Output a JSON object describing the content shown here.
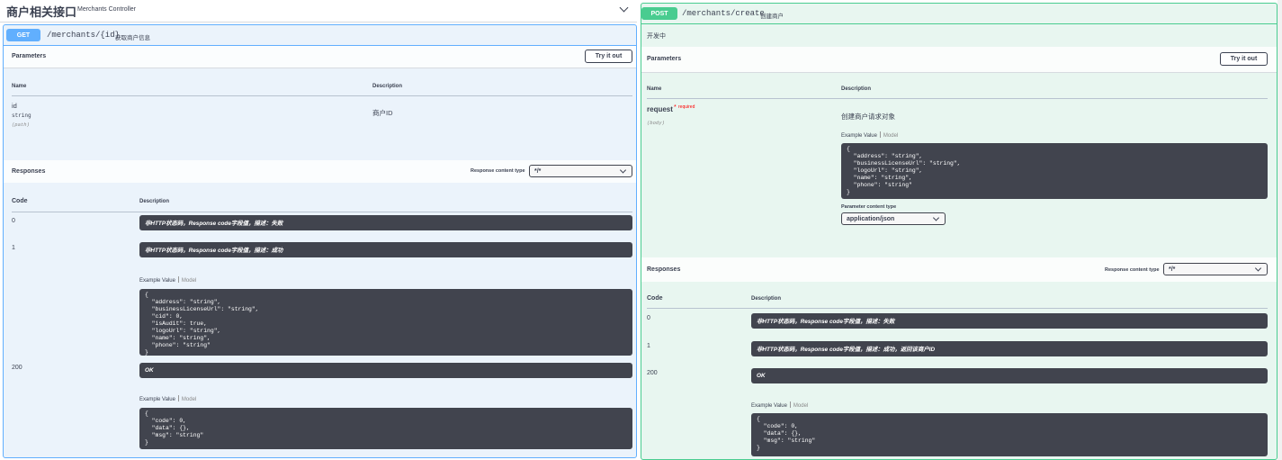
{
  "left": {
    "section_title": "商户相关接口",
    "section_subtitle": "Merchants Controller",
    "op": {
      "method": "GET",
      "path": "/merchants/{id}",
      "summary": "获取商户信息",
      "parameters_title": "Parameters",
      "try_label": "Try it out",
      "col_name": "Name",
      "col_description": "Description",
      "param": {
        "name": "id",
        "type": "string",
        "in": "(path)",
        "description": "商户ID"
      },
      "responses_title": "Responses",
      "content_type_label": "Response content type",
      "content_type_value": "*/*",
      "code_header": "Code",
      "desc_header": "Description",
      "responses": [
        {
          "code": "0",
          "desc": "非HTTP状态码，Response code字段值，描述：失败"
        },
        {
          "code": "1",
          "desc": "非HTTP状态码，Response code字段值，描述：成功"
        },
        {
          "code": "200",
          "desc": "OK"
        }
      ],
      "example_value": "Example Value",
      "model": "Model",
      "example1": "{\n  \"address\": \"string\",\n  \"businessLicenseUrl\": \"string\",\n  \"cid\": 0,\n  \"isAudit\": true,\n  \"logoUrl\": \"string\",\n  \"name\": \"string\",\n  \"phone\": \"string\"\n}",
      "example2": "{\n  \"code\": 0,\n  \"data\": {},\n  \"msg\": \"string\"\n}"
    }
  },
  "right": {
    "op": {
      "method": "POST",
      "path": "/merchants/create",
      "summary": "创建商户",
      "description": "开发中",
      "parameters_title": "Parameters",
      "try_label": "Try it out",
      "col_name": "Name",
      "col_description": "Description",
      "param": {
        "name": "request",
        "required_mark": "*",
        "required": "required",
        "in": "(body)",
        "description": "创建商户请求对象"
      },
      "example_value": "Example Value",
      "model": "Model",
      "example_body": "{\n  \"address\": \"string\",\n  \"businessLicenseUrl\": \"string\",\n  \"logoUrl\": \"string\",\n  \"name\": \"string\",\n  \"phone\": \"string\"\n}",
      "param_content_type_label": "Parameter content type",
      "param_content_type_value": "application/json",
      "responses_title": "Responses",
      "content_type_label": "Response content type",
      "content_type_value": "*/*",
      "code_header": "Code",
      "desc_header": "Description",
      "responses": [
        {
          "code": "0",
          "desc": "非HTTP状态码，Response code字段值，描述：失败"
        },
        {
          "code": "1",
          "desc": "非HTTP状态码，Response code字段值，描述：成功，返回该商户ID"
        },
        {
          "code": "200",
          "desc": "OK"
        }
      ],
      "example2": "{\n  \"code\": 0,\n  \"data\": {},\n  \"msg\": \"string\"\n}"
    }
  },
  "colors": {
    "get": "#61affe",
    "get_bg": "#ebf3fb",
    "post": "#49cc90",
    "post_bg": "#e8f6f0",
    "code_bg": "#41444e"
  }
}
